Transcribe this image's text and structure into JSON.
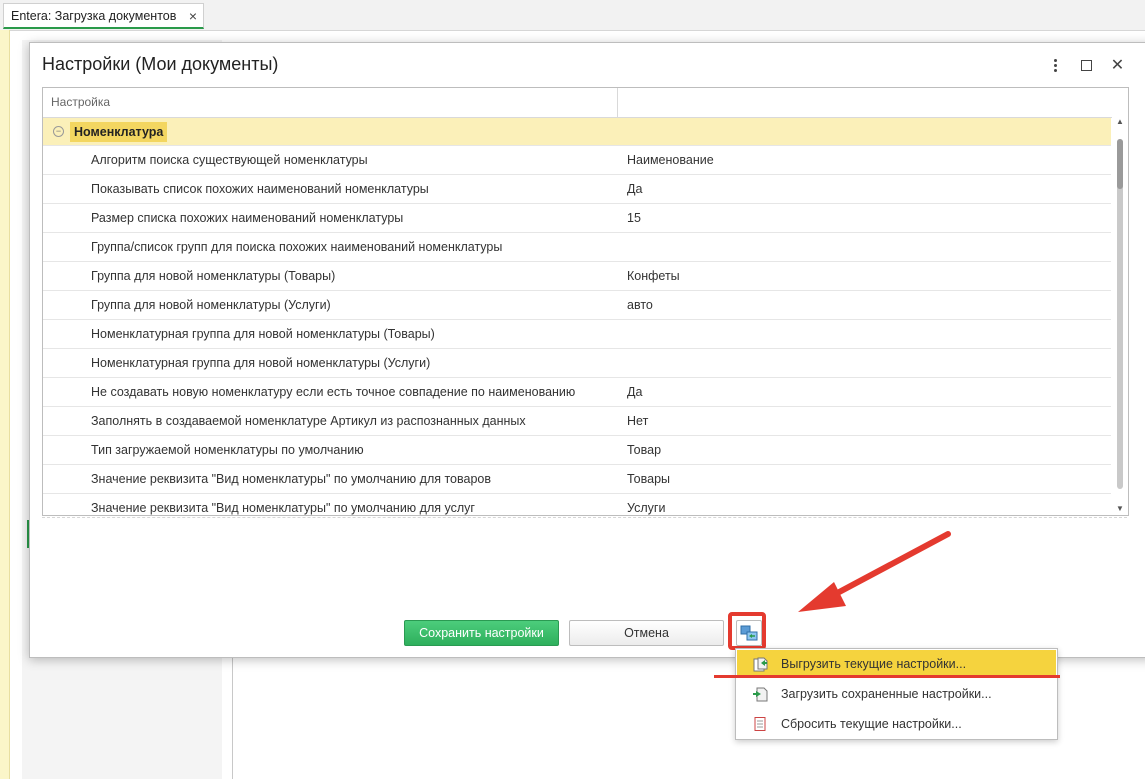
{
  "app": {
    "tab_title": "Entera: Загрузка документов"
  },
  "dialog": {
    "title": "Настройки (Мои документы)"
  },
  "grid": {
    "headers": [
      "Настройка",
      ""
    ],
    "group": "Номенклатура",
    "rows": [
      [
        "Алгоритм поиска существующей номенклатуры",
        "Наименование"
      ],
      [
        "Показывать список похожих наименований номенклатуры",
        "Да"
      ],
      [
        "Размер списка похожих наименований номенклатуры",
        "15"
      ],
      [
        "Группа/список групп для поиска похожих наименований номенклатуры",
        ""
      ],
      [
        "Группа для новой номенклатуры (Товары)",
        "Конфеты"
      ],
      [
        "Группа для новой номенклатуры (Услуги)",
        "авто"
      ],
      [
        "Номенклатурная группа для новой номенклатуры (Товары)",
        ""
      ],
      [
        "Номенклатурная группа для новой номенклатуры (Услуги)",
        ""
      ],
      [
        "Не создавать новую номенклатуру если есть точное совпадение по наименованию",
        "Да"
      ],
      [
        "Заполнять в создаваемой номенклатуре Артикул из распознанных данных",
        "Нет"
      ],
      [
        "Тип загружаемой номенклатуры по умолчанию",
        "Товар"
      ],
      [
        "Значение реквизита \"Вид номенклатуры\" по умолчанию для товаров",
        "Товары"
      ],
      [
        "Значение реквизита \"Вид номенклатуры\" по умолчанию для услуг",
        "Услуги"
      ]
    ]
  },
  "buttons": {
    "save": "Сохранить настройки",
    "cancel": "Отмена"
  },
  "menu": {
    "items": [
      {
        "label": "Выгрузить текущие настройки...",
        "icon": "export-settings-icon"
      },
      {
        "label": "Загрузить сохраненные настройки...",
        "icon": "import-settings-icon"
      },
      {
        "label": "Сбросить текущие настройки...",
        "icon": "reset-settings-icon"
      }
    ]
  },
  "colors": {
    "accent_green": "#2eaf5c",
    "highlight_yellow": "#f5d33e",
    "annotation_red": "#e43a2f"
  }
}
